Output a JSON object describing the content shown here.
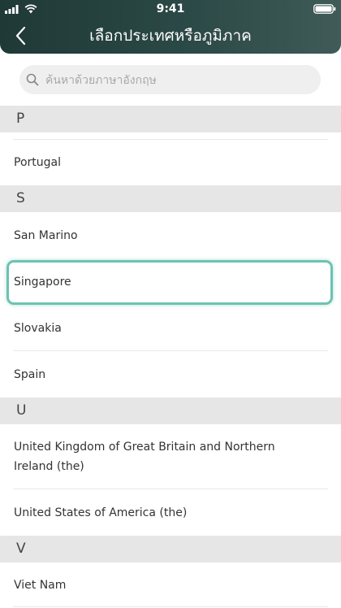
{
  "status_bar": {
    "time": "9:41"
  },
  "header": {
    "title": "เลือกประเทศหรือภูมิภาค"
  },
  "search": {
    "placeholder": "ค้นหาด้วยภาษาอังกฤษ",
    "value": ""
  },
  "sections": [
    {
      "letter": "P",
      "items": [
        "Portugal"
      ]
    },
    {
      "letter": "S",
      "items": [
        "San Marino",
        "Singapore",
        "Slovakia",
        "Spain"
      ]
    },
    {
      "letter": "U",
      "items": [
        "United Kingdom of Great Britain and Northern Ireland (the)",
        "United States of America (the)"
      ]
    },
    {
      "letter": "V",
      "items": [
        "Viet Nam"
      ]
    }
  ],
  "selected_item": "Singapore",
  "colors": {
    "header_bg": "#2b4946",
    "highlight": "#6cc3b2",
    "section_bg": "#e6e6e6"
  }
}
